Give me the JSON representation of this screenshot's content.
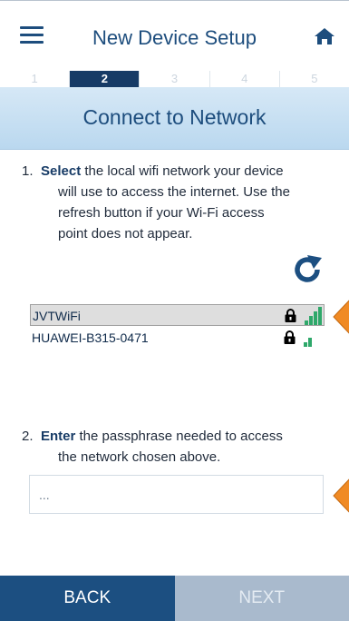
{
  "header": {
    "title": "New Device Setup",
    "menu_icon": "hamburger-menu-icon",
    "home_icon": "home-icon"
  },
  "steps": [
    {
      "label": "1",
      "active": false
    },
    {
      "label": "2",
      "active": true
    },
    {
      "label": "3",
      "active": false
    },
    {
      "label": "4",
      "active": false
    },
    {
      "label": "5",
      "active": false
    }
  ],
  "section_title": "Connect to Network",
  "instruction1": {
    "number": "1.",
    "emphasis": "Select",
    "text": " the local wifi network your device will use to access the internet. Use the refresh button if your Wi-Fi access point does not appear."
  },
  "refresh_icon": "refresh-icon",
  "networks": [
    {
      "name": "JVTWiFi",
      "selected": true,
      "locked": true,
      "signal_bars": 3
    },
    {
      "name": "HUAWEI-B315-0471",
      "selected": false,
      "locked": true,
      "signal_bars": 1
    }
  ],
  "instruction2": {
    "number": "2.",
    "emphasis": "Enter",
    "text": " the passphrase needed to access the network chosen above."
  },
  "passphrase": {
    "value": "..."
  },
  "nav": {
    "back_label": "BACK",
    "next_label": "NEXT"
  },
  "colors": {
    "primary": "#1c4f81",
    "accent_arrow": "#f08a24",
    "signal": "#2ea86a",
    "disabled": "#a9bacd"
  }
}
